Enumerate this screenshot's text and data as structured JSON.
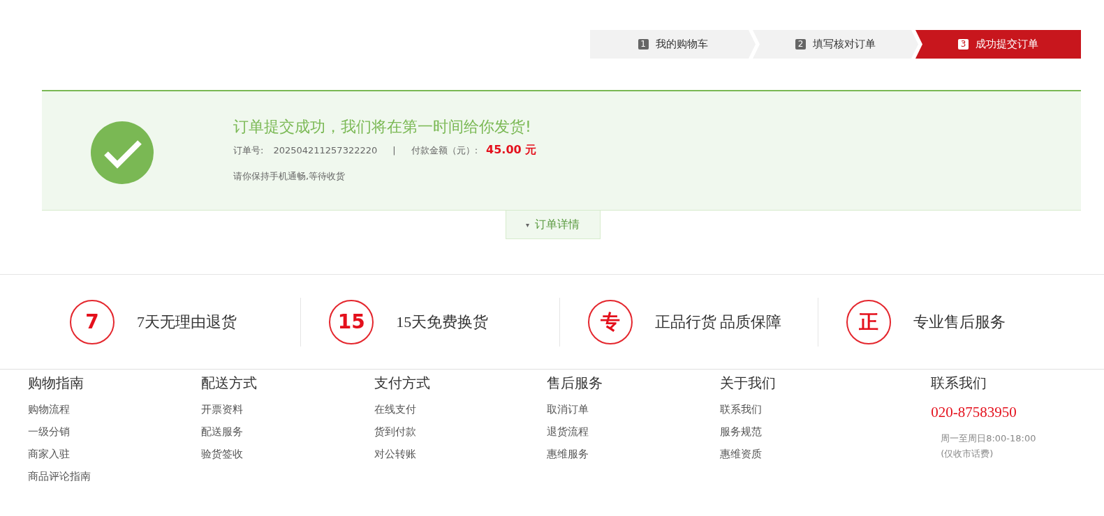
{
  "steps": [
    {
      "number": "1",
      "label": "我的购物车",
      "selected": false
    },
    {
      "number": "2",
      "label": "填写核对订单",
      "selected": false
    },
    {
      "number": "3",
      "label": "成功提交订单",
      "selected": true
    }
  ],
  "success": {
    "title": "订单提交成功，我们将在第一时间给你发货!",
    "order_label": "订单号:",
    "order_number": "202504211257322220",
    "separator": "|",
    "amount_label": "付款金额（元）:",
    "amount": "45.00 元",
    "note": "请你保持手机通畅,等待收货"
  },
  "details_toggle": {
    "caret": "▾",
    "label": "订单详情"
  },
  "guarantees": [
    {
      "badge": "7",
      "text": "7天无理由退货"
    },
    {
      "badge": "15",
      "text": "15天免费换货"
    },
    {
      "badge": "专",
      "text": "正品行货  品质保障"
    },
    {
      "badge": "正",
      "text": "专业售后服务"
    }
  ],
  "footer": {
    "columns": [
      {
        "title": "购物指南",
        "links": [
          "购物流程",
          "一级分销",
          "商家入驻",
          "商品评论指南"
        ]
      },
      {
        "title": "配送方式",
        "links": [
          "开票资料",
          "配送服务",
          "验货签收"
        ]
      },
      {
        "title": "支付方式",
        "links": [
          "在线支付",
          "货到付款",
          "对公转账"
        ]
      },
      {
        "title": "售后服务",
        "links": [
          "取消订单",
          "退货流程",
          "惠维服务"
        ]
      },
      {
        "title": "关于我们",
        "links": [
          "联系我们",
          "服务规范",
          "惠维资质"
        ]
      }
    ],
    "contact": {
      "title": "联系我们",
      "phone": "020-87583950",
      "hours": "周一至周日8:00-18:00",
      "note": "(仅收市话费)"
    }
  }
}
